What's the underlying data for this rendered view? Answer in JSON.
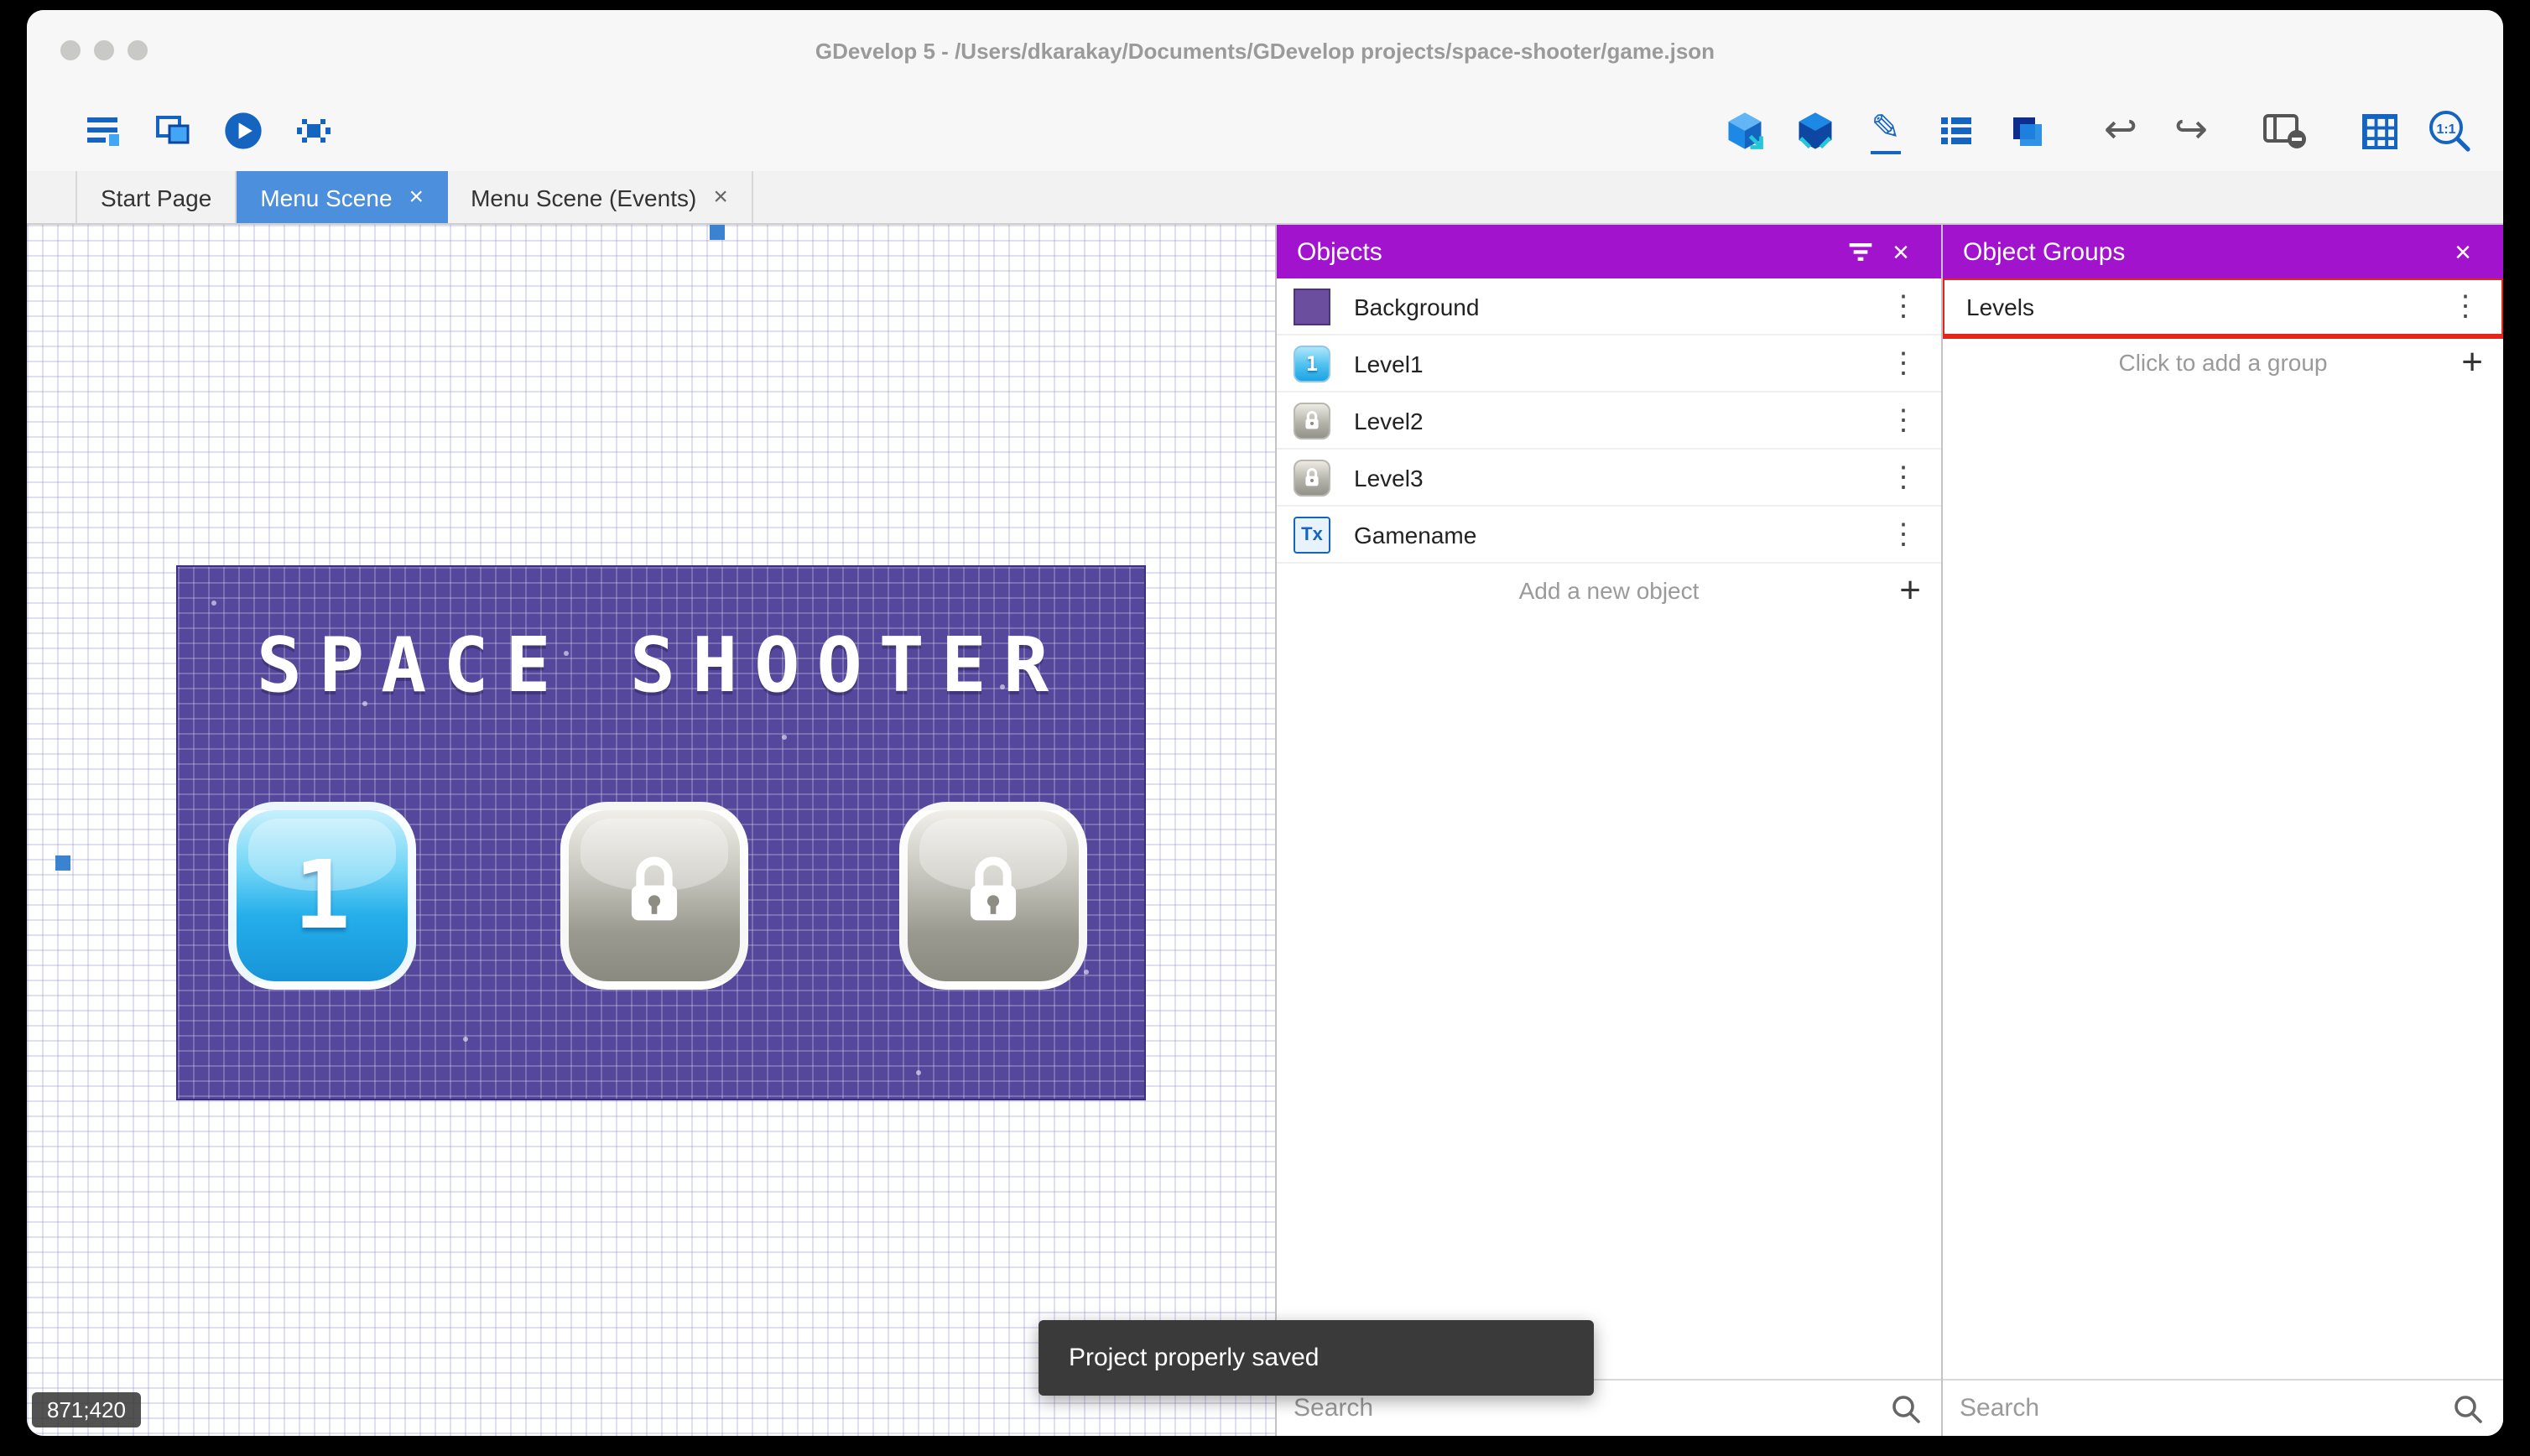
{
  "colors": {
    "header_purple": "#a213ce",
    "active_tab_blue": "#4b8fdd",
    "toolbar_icon_blue": "#1565c0",
    "highlight_red": "#e5241c",
    "scene_purple": "#55489c",
    "level_button_blue": "#24aeea",
    "level_button_gray": "#9a998f"
  },
  "glyphs": {
    "close": "×",
    "plus": "+",
    "kebab": "⋮",
    "undo": "↩",
    "redo": "↪",
    "pencil": "✎"
  },
  "window": {
    "title": "GDevelop 5 - /Users/dkarakay/Documents/GDevelop projects/space-shooter/game.json"
  },
  "tabs": [
    {
      "label": "Start Page"
    },
    {
      "label": "Menu Scene"
    },
    {
      "label": "Menu Scene (Events)"
    }
  ],
  "toolbar": {
    "left_icons": [
      "project-manager-icon",
      "scene-window-icon",
      "play-icon",
      "debug-icon"
    ],
    "right_icons": [
      "objects-editor-icon",
      "instances-editor-icon",
      "edit-pencil-icon",
      "events-list-icon",
      "layers-icon",
      "undo-icon",
      "redo-icon",
      "window-mask-icon",
      "grid-icon",
      "zoom-1-1-icon"
    ],
    "zoom_label": "1:1"
  },
  "scene": {
    "title": "SPACE SHOOTER",
    "level1_label": "1",
    "coordinates": "871;420"
  },
  "toast": {
    "message": "Project properly saved"
  },
  "objects_panel": {
    "title": "Objects",
    "items": [
      {
        "name": "Background"
      },
      {
        "name": "Level1",
        "thumb_label": "1"
      },
      {
        "name": "Level2"
      },
      {
        "name": "Level3"
      },
      {
        "name": "Gamename",
        "thumb_label": "Tx"
      }
    ],
    "add_label": "Add a new object",
    "search_placeholder": "Search"
  },
  "groups_panel": {
    "title": "Object Groups",
    "items": [
      {
        "name": "Levels"
      }
    ],
    "add_label": "Click to add a group",
    "search_placeholder": "Search"
  }
}
